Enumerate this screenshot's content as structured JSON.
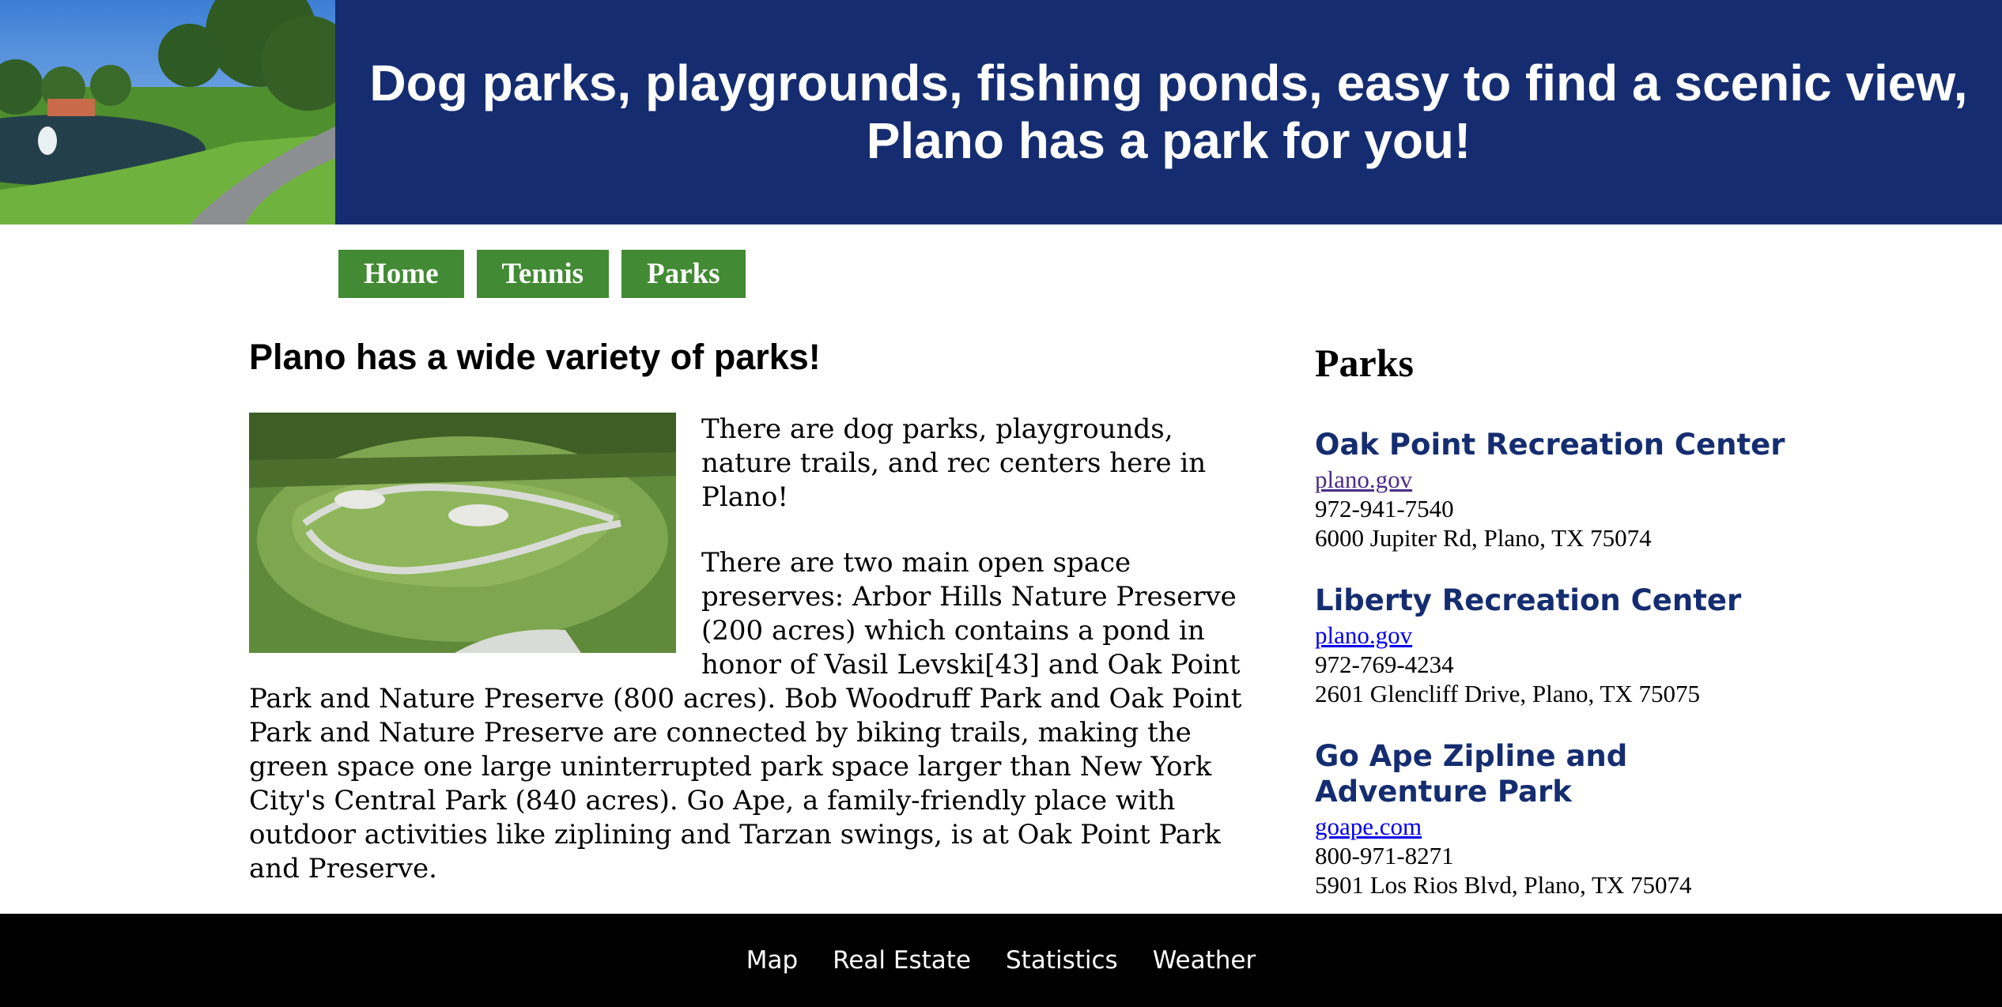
{
  "header": {
    "title_line1": "Dog parks, playgrounds, fishing ponds, easy to find a scenic view,",
    "title_line2": "Plano has a park for you!"
  },
  "nav": {
    "items": [
      {
        "label": "Home"
      },
      {
        "label": "Tennis"
      },
      {
        "label": "Parks"
      }
    ],
    "color": "#428a33"
  },
  "main": {
    "heading": "Plano has a wide variety of parks!",
    "paragraphs": [
      "There are dog parks, playgrounds, nature trails, and rec centers here in Plano!",
      "There are two main open space preserves: Arbor Hills Nature Preserve (200 acres) which contains a pond in honor of Vasil Levski[43] and Oak Point Park and Nature Preserve (800 acres). Bob Woodruff Park and Oak Point Park and Nature Preserve are connected by biking trails, making the green space one large uninterrupted park space larger than New York City's Central Park (840 acres). Go Ape, a family-friendly place with outdoor activities like ziplining and Tarzan swings, is at Oak Point Park and Preserve."
    ]
  },
  "aside": {
    "heading": "Parks",
    "parks": [
      {
        "name": "Oak Point Recreation Center",
        "link": "plano.gov",
        "link_color": "#4b2c87",
        "phone": "972-941-7540",
        "address": "6000 Jupiter Rd, Plano, TX 75074"
      },
      {
        "name": "Liberty Recreation Center",
        "link": "plano.gov",
        "link_color": "#0000ee",
        "phone": "972-769-4234",
        "address": "2601 Glencliff Drive, Plano, TX 75075"
      },
      {
        "name_line1": "Go Ape Zipline and",
        "name_line2": "Adventure Park",
        "link": "goape.com",
        "link_color": "#0000ee",
        "phone": "800-971-8271",
        "address": "5901 Los Rios Blvd, Plano, TX 75074"
      }
    ]
  },
  "footer": {
    "links": [
      "Map",
      "Real Estate",
      "Statistics",
      "Weather"
    ]
  },
  "colors": {
    "header_bg": "#152d70",
    "accent_heading": "#152d70",
    "footer_bg": "#000000"
  }
}
